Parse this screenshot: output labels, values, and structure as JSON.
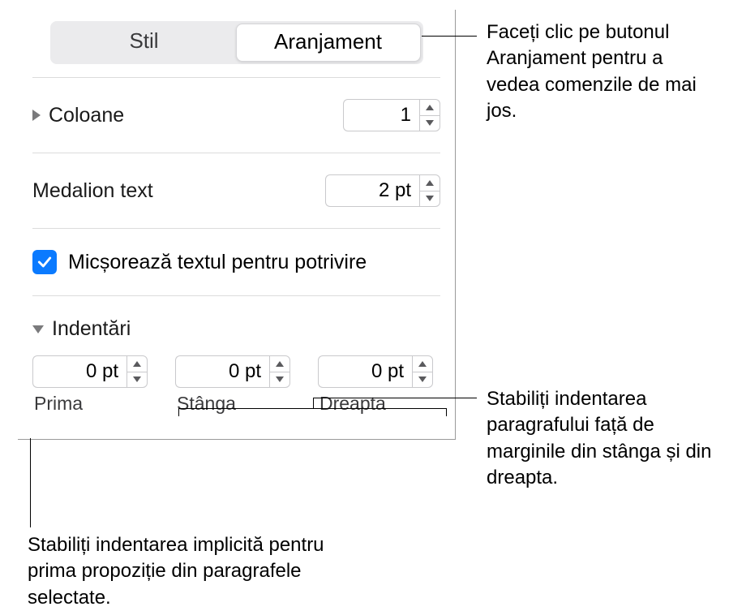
{
  "tabs": {
    "stil": "Stil",
    "aranjament": "Aranjament"
  },
  "columns": {
    "label": "Coloane",
    "value": "1"
  },
  "medallion": {
    "label": "Medalion text",
    "value": "2 pt"
  },
  "shrink": {
    "label": "Micșorează textul pentru potrivire",
    "checked": true
  },
  "indents": {
    "label": "Indentări",
    "prima": {
      "value": "0 pt",
      "caption": "Prima"
    },
    "stanga": {
      "value": "0 pt",
      "caption": "Stânga"
    },
    "dreapta": {
      "value": "0 pt",
      "caption": "Dreapta"
    }
  },
  "callouts": {
    "top": "Faceți clic pe butonul Aranjament pentru a vedea comenzile de mai jos.",
    "right": "Stabiliți indentarea paragrafului față de marginile din stânga și din dreapta.",
    "bottom": "Stabiliți indentarea implicită pentru prima propoziție din paragrafele selectate."
  }
}
